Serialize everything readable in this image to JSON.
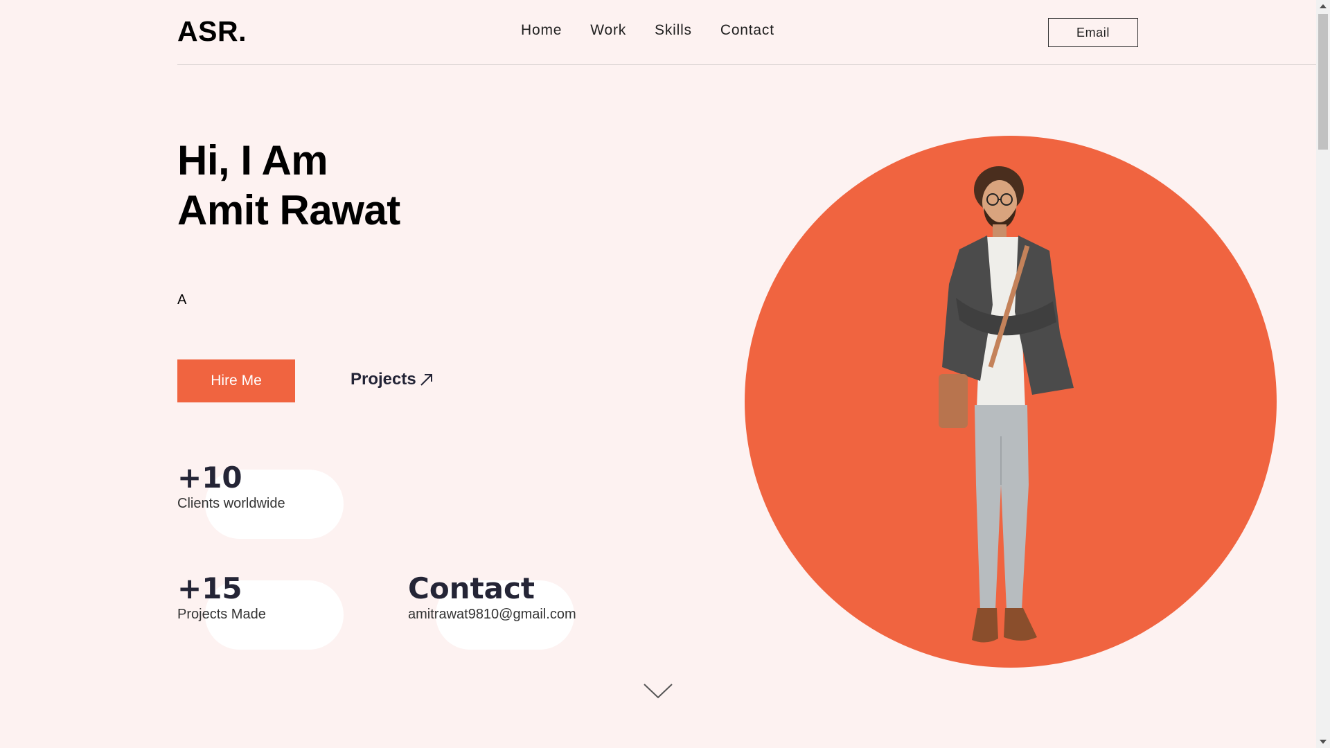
{
  "header": {
    "logo": "ASR.",
    "nav": [
      "Home",
      "Work",
      "Skills",
      "Contact"
    ],
    "email_button": "Email"
  },
  "hero": {
    "title_line1": "Hi, I Am",
    "title_line2": "Amit Rawat",
    "typed_text": "A",
    "hire_button": "Hire Me",
    "projects_link": "Projects"
  },
  "stats": [
    {
      "value": "+10",
      "label": "Clients worldwide"
    },
    {
      "value": "+15",
      "label": "Projects Made"
    },
    {
      "value": "Contact",
      "label": "amitrawat9810@gmail.com"
    }
  ],
  "colors": {
    "background": "#fdf2f1",
    "accent": "#f06440",
    "dark_text": "#242536"
  },
  "icons": {
    "projects_arrow": "arrow-up-right-icon",
    "scroll_down": "chevron-down-icon"
  }
}
